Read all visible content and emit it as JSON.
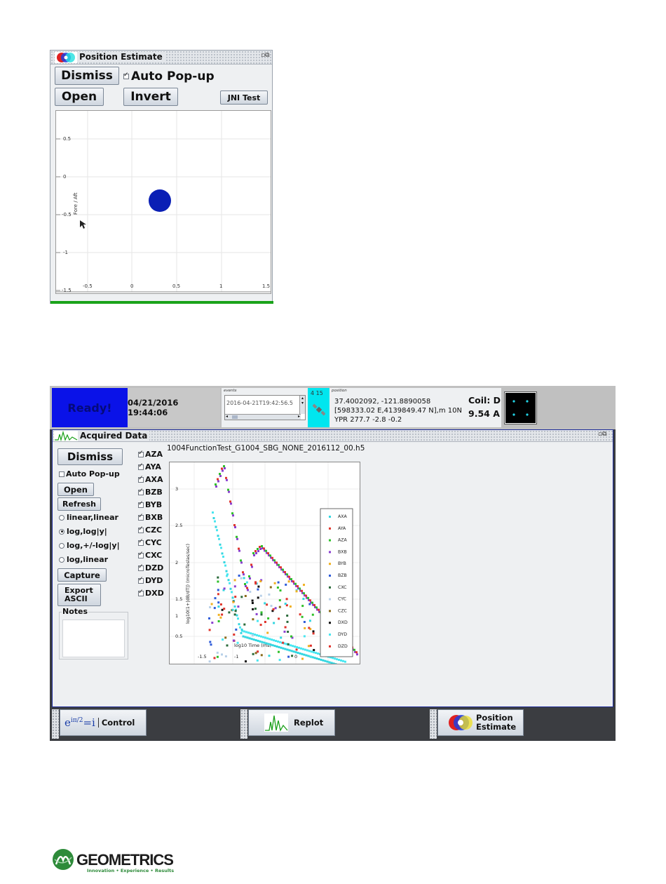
{
  "position_estimate": {
    "title": "Position Estimate",
    "dismiss_label": "Dismiss",
    "auto_popup_label": "Auto Pop-up",
    "auto_popup_checked": true,
    "open_label": "Open",
    "invert_label": "Invert",
    "jni_label": "JNI Test",
    "plot": {
      "ylabel": "Fore / Aft",
      "xticks": [
        "-0.5",
        "0",
        "0.5",
        "1",
        "1.5"
      ],
      "yticks": [
        "0.5",
        "0",
        "-0.5",
        "-1",
        "-1.5"
      ],
      "marker_color": "#0a1fb5"
    }
  },
  "status": {
    "ready_text": "Ready!",
    "datetime": "04/21/2016 19:44:06",
    "events_label": "events",
    "events_line_partial": "2016-04-21T19:42:56.5",
    "cyan_value": "4 15",
    "position_label": "position",
    "position_line1": "37.4002092, -121.8890058",
    "position_line2": "[598333.02 E,4139849.47 N],m 10N",
    "position_line3": "YPR 277.7 -2.8 -0.2",
    "coil_label": "Coil: D",
    "coil_current": "9.54 A"
  },
  "acquired": {
    "title": "Acquired Data",
    "dismiss_label": "Dismiss",
    "auto_popup_label": "Auto Pop-up",
    "auto_popup_checked": false,
    "open_label": "Open",
    "refresh_label": "Refresh",
    "scale_options": [
      "linear,linear",
      "log,log|y|",
      "log,+/-log|y|",
      "log,linear"
    ],
    "scale_selected_index": 1,
    "capture_label": "Capture",
    "export_line1": "Export",
    "export_line2": "ASCII",
    "notes_label": "Notes",
    "channels": [
      "AZA",
      "AYA",
      "AXA",
      "BZB",
      "BYB",
      "BXB",
      "CZC",
      "CYC",
      "CXC",
      "DZD",
      "DYD",
      "DXD"
    ],
    "plot_title": "1004FunctionTest_G1004_SBG_NONE_2016112_00.h5",
    "plot_ylabel": "log10(1+|dB/dT|) (microTeslas/sec)",
    "plot_xlabel": "log10 Time (ms)",
    "y_ticks": [
      "3",
      "2.5",
      "2",
      "1.5",
      "1",
      "0.5"
    ],
    "x_ticks": [
      "-1.5",
      "-1",
      "0"
    ],
    "legend": [
      {
        "name": "AXA",
        "color": "#33d6e0"
      },
      {
        "name": "AYA",
        "color": "#e0362c"
      },
      {
        "name": "AZA",
        "color": "#2fc02a"
      },
      {
        "name": "BXB",
        "color": "#8a3fd0"
      },
      {
        "name": "BYB",
        "color": "#f0b020"
      },
      {
        "name": "BZB",
        "color": "#2e5bd8"
      },
      {
        "name": "CXC",
        "color": "#2a6a3a"
      },
      {
        "name": "CYC",
        "color": "#b8d0e8"
      },
      {
        "name": "CZC",
        "color": "#8a6a1a"
      },
      {
        "name": "DXD",
        "color": "#111111"
      },
      {
        "name": "DYD",
        "color": "#49e6f0"
      },
      {
        "name": "DZD",
        "color": "#e0302a"
      }
    ]
  },
  "taskbar": {
    "control_formula": "e",
    "control_label": "Control",
    "replot_label": "Replot",
    "position_line1": "Position",
    "position_line2": "Estimate"
  },
  "logo": {
    "name": "GEOMETRICS",
    "tagline": "Innovation • Experience • Results"
  }
}
